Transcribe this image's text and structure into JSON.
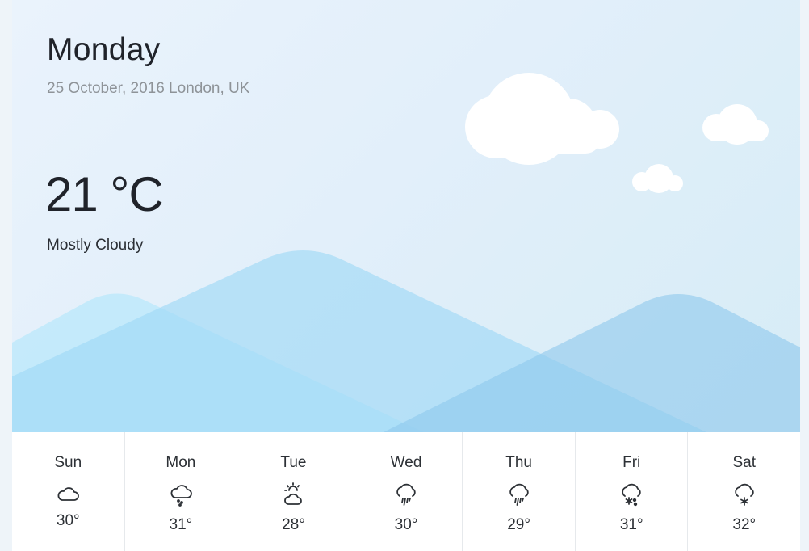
{
  "current": {
    "day": "Monday",
    "date_location": "25 October, 2016 London, UK",
    "temperature": "21 °C",
    "condition": "Mostly Cloudy"
  },
  "forecast": [
    {
      "day": "Sun",
      "temp": "30°",
      "icon": "cloud-icon"
    },
    {
      "day": "Mon",
      "temp": "31°",
      "icon": "cloud-drizzle-icon"
    },
    {
      "day": "Tue",
      "temp": "28°",
      "icon": "sun-behind-cloud-icon"
    },
    {
      "day": "Wed",
      "temp": "30°",
      "icon": "cloud-rain-icon"
    },
    {
      "day": "Thu",
      "temp": "29°",
      "icon": "cloud-rain-icon"
    },
    {
      "day": "Fri",
      "temp": "31°",
      "icon": "cloud-sleet-icon"
    },
    {
      "day": "Sat",
      "temp": "32°",
      "icon": "cloud-snow-icon"
    }
  ],
  "colors": {
    "text_dark": "#20232a",
    "text_muted": "#8e9398",
    "mountain_light": "#b8e4f8",
    "mountain_mid": "#a6dcf5",
    "mountain_dark": "#8ccbee",
    "cloud": "#ffffff"
  }
}
